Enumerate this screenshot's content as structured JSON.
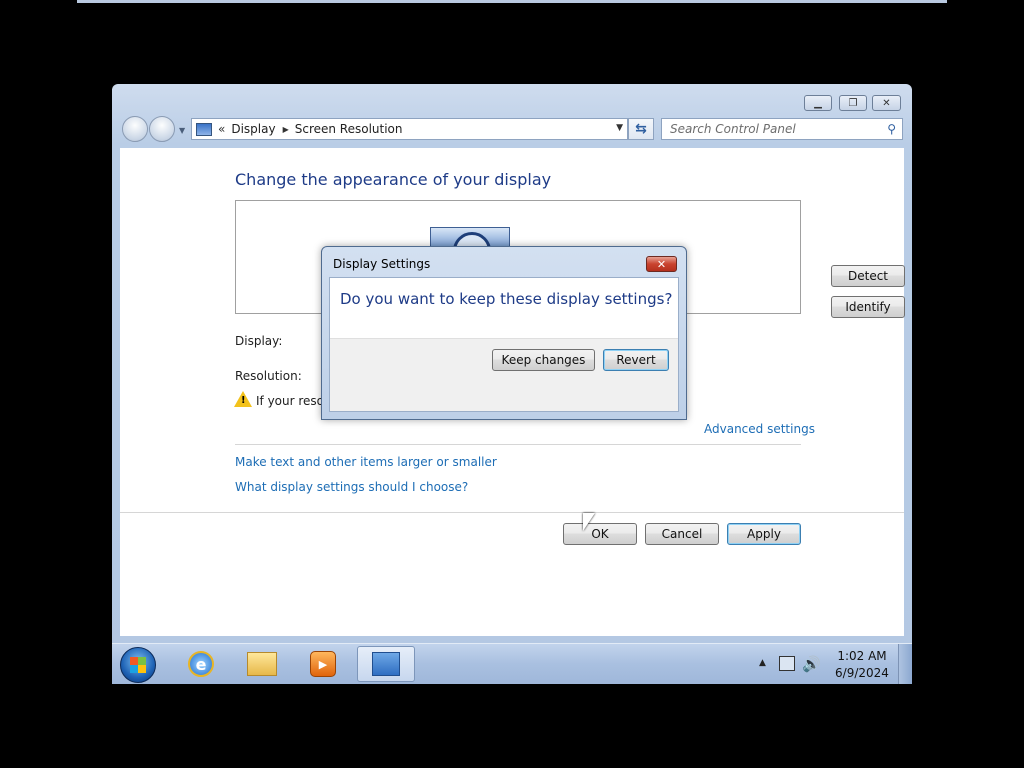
{
  "address_bar": {
    "breadcrumbs": [
      "Display",
      "Screen Resolution"
    ],
    "chevron": "«"
  },
  "search": {
    "placeholder": "Search Control Panel"
  },
  "main": {
    "title": "Change the appearance of your display",
    "detect_label": "Detect",
    "identify_label": "Identify",
    "display_label": "Display:",
    "resolution_label": "Resolution:",
    "warning_text": "If your resol",
    "advanced_link": "Advanced settings",
    "link_text_size": "Make text and other items larger or smaller",
    "link_which_settings": "What display settings should I choose?",
    "ok_label": "OK",
    "cancel_label": "Cancel",
    "apply_label": "Apply"
  },
  "dialog": {
    "title": "Display Settings",
    "question": "Do you want to keep these display settings?",
    "keep_label": "Keep changes",
    "revert_label": "Revert",
    "close_glyph": "✕"
  },
  "taskbar": {
    "time": "1:02 AM",
    "date": "6/9/2024",
    "pinned": [
      "internet-explorer-icon",
      "windows-explorer-icon",
      "media-player-icon",
      "control-panel-icon"
    ]
  },
  "colors": {
    "heading": "#1e3b87",
    "link": "#1d6db5",
    "taskbar": "#a9c0e0"
  }
}
